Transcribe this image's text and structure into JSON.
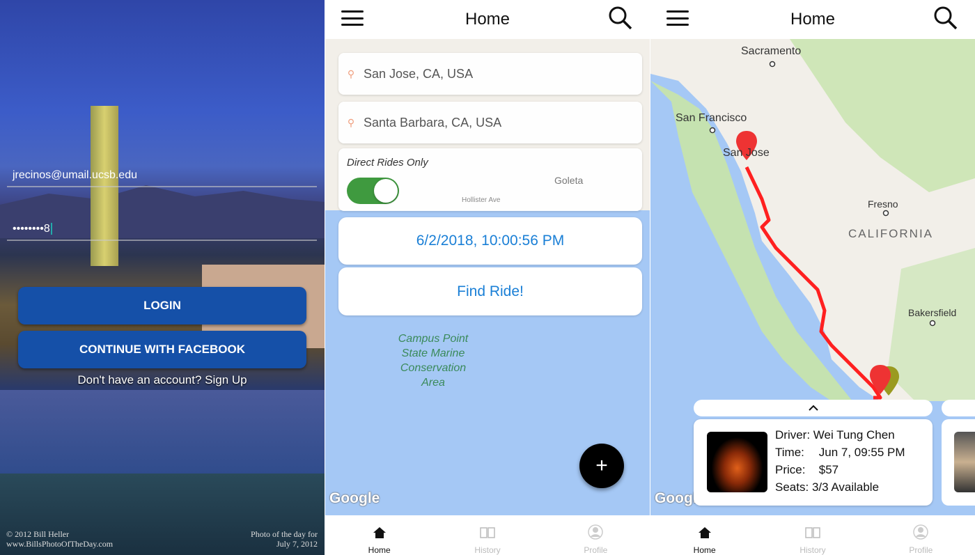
{
  "login": {
    "email": "jrecinos@umail.ucsb.edu",
    "password": "••••••••8",
    "login_label": "LOGIN",
    "facebook_label": "CONTINUE WITH FACEBOOK",
    "signup_text": "Don't have an account? Sign Up",
    "credit_left": [
      "© 2012 Bill Heller",
      "www.BillsPhotoOfTheDay.com"
    ],
    "credit_right": [
      "Photo of the day for",
      "July 7, 2012"
    ]
  },
  "search": {
    "title": "Home",
    "from": "San Jose, CA, USA",
    "to": "Santa Barbara, CA, USA",
    "direct_label": "Direct Rides Only",
    "direct_on": true,
    "datetime": "6/2/2018, 10:00:56 PM",
    "find_label": "Find Ride!",
    "map_labels": [
      "Goleta",
      "Hollister Ave",
      "Campus Point State Marine Conservation Area"
    ],
    "google": "Google",
    "fab": "+"
  },
  "results": {
    "title": "Home",
    "map_labels": [
      "Sacramento",
      "San Francisco",
      "San Jose",
      "Fresno",
      "CALIFORNIA",
      "Bakersfield"
    ],
    "google": "Google",
    "ride": {
      "driver_label": "Driver:",
      "driver": "Wei Tung Chen",
      "time_label": "Time:",
      "time": "Jun 7, 09:55 PM",
      "price_label": "Price:",
      "price": "$57",
      "seats_label": "Seats:",
      "seats": "3/3 Available"
    }
  },
  "tabs": [
    {
      "label": "Home",
      "icon": "home-icon"
    },
    {
      "label": "History",
      "icon": "book-icon"
    },
    {
      "label": "Profile",
      "icon": "profile-icon"
    }
  ],
  "colors": {
    "accent": "#1a7fd6",
    "button_blue": "#1550a8",
    "toggle": "#3f9a3f",
    "route": "#ff2020"
  }
}
